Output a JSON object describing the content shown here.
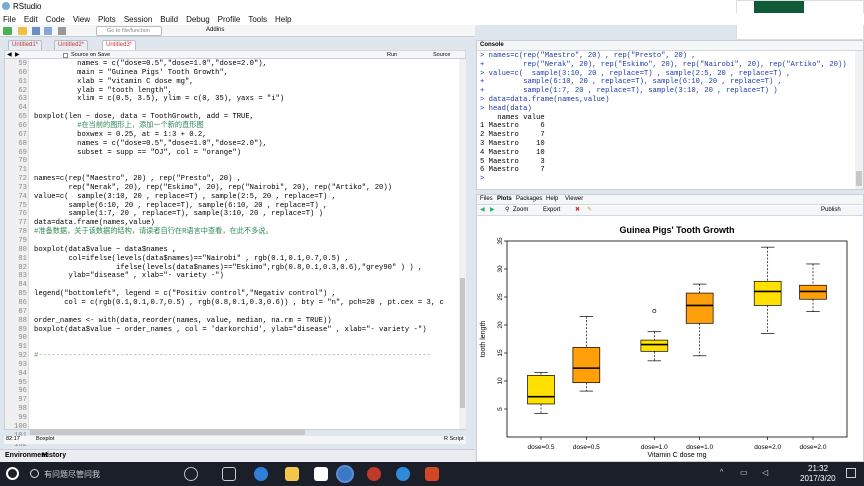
{
  "app": {
    "title": "RStudio"
  },
  "menu": [
    "File",
    "Edit",
    "Code",
    "View",
    "Plots",
    "Session",
    "Build",
    "Debug",
    "Profile",
    "Tools",
    "Help"
  ],
  "toolbar": {
    "goto_placeholder": "Go to file/function",
    "addins": "Addins"
  },
  "editor_tabs": [
    {
      "label": "Untitled1*"
    },
    {
      "label": "Untitled2*"
    },
    {
      "label": "Untitled3*"
    }
  ],
  "editor_toolbar": {
    "source_on_save": "Source on Save",
    "run": "Run",
    "source": "Source"
  },
  "editor": {
    "lines": [
      {
        "n": "59",
        "code": "          names = c(\"dose=0.5\",\"dose=1.0\",\"dose=2.0\"),"
      },
      {
        "n": "60",
        "code": "          main = \"Guinea Pigs' Tooth Growth\","
      },
      {
        "n": "61",
        "code": "          xlab = \"vitamin C dose mg\","
      },
      {
        "n": "62",
        "code": "          ylab = \"tooth length\","
      },
      {
        "n": "63",
        "code": "          xlim = c(0.5, 3.5), ylim = c(0, 35), yaxs = \"i\")"
      },
      {
        "n": "64",
        "code": ""
      },
      {
        "n": "65",
        "code": "boxplot(len ~ dose, data = ToothGrowth, add = TRUE,"
      },
      {
        "n": "66",
        "code": "          #在当前的图形上，添加一个新的直形图"
      },
      {
        "n": "67",
        "code": "          boxwex = 0.25, at = 1:3 + 0.2,"
      },
      {
        "n": "68",
        "code": "          names = c(\"dose=0.5\",\"dose=1.0\",\"dose=2.0\"),"
      },
      {
        "n": "69",
        "code": "          subset = supp == \"OJ\", col = \"orange\")"
      },
      {
        "n": "70",
        "code": ""
      },
      {
        "n": "71",
        "code": ""
      },
      {
        "n": "72",
        "code": "names=c(rep(\"Maestro\", 20) , rep(\"Presto\", 20) ,"
      },
      {
        "n": "73",
        "code": "        rep(\"Nerak\", 20), rep(\"Eskimo\", 20), rep(\"Nairobi\", 20), rep(\"Artiko\", 20))"
      },
      {
        "n": "74",
        "code": "value=c(  sample(3:10, 20 , replace=T) , sample(2:5, 20 , replace=T) ,"
      },
      {
        "n": "75",
        "code": "        sample(6:10, 20 , replace=T), sample(6:10, 20 , replace=T) ,"
      },
      {
        "n": "76",
        "code": "        sample(1:7, 20 , replace=T), sample(3:10, 20 , replace=T) )"
      },
      {
        "n": "77",
        "code": "data=data.frame(names,value)"
      },
      {
        "n": "78",
        "code": "#准备数据，关于该数据的结构，请读者自行在R语言中查看，在此不多说。"
      },
      {
        "n": "79",
        "code": ""
      },
      {
        "n": "80",
        "code": "boxplot(data$value ~ data$names ,"
      },
      {
        "n": "81",
        "code": "        col=ifelse(levels(data$names)==\"Nairobi\" , rgb(0.1,0.1,0.7,0.5) ,"
      },
      {
        "n": "82",
        "code": "                   ifelse(levels(data$names)==\"Eskimo\",rgb(0.8,0.1,0.3,0.6),\"grey90\" ) ) ,"
      },
      {
        "n": "83",
        "code": "        ylab=\"disease\" , xlab=\"- variety -\")"
      },
      {
        "n": "84",
        "code": ""
      },
      {
        "n": "85",
        "code": "legend(\"bottomleft\", legend = c(\"Positiv control\",\"Negativ control\") ,"
      },
      {
        "n": "86",
        "code": "       col = c(rgb(0.1,0.1,0.7,0.5) , rgb(0.8,0.1,0.3,0.6)) , bty = \"n\", pch=20 , pt.cex = 3, c"
      },
      {
        "n": "87",
        "code": ""
      },
      {
        "n": "88",
        "code": "order_names <- with(data,reorder(names, value, median, na.rm = TRUE))"
      },
      {
        "n": "89",
        "code": "boxplot(data$value ~ order_names , col = 'darkorchid', ylab=\"disease\" , xlab=\"- variety -\")"
      },
      {
        "n": "90",
        "code": ""
      },
      {
        "n": "91",
        "code": ""
      },
      {
        "n": "92",
        "code": "#-------------------------------------------------------------------------------------------"
      },
      {
        "n": "93",
        "code": ""
      },
      {
        "n": "94",
        "code": ""
      },
      {
        "n": "95",
        "code": ""
      },
      {
        "n": "96",
        "code": ""
      },
      {
        "n": "97",
        "code": ""
      },
      {
        "n": "98",
        "code": ""
      },
      {
        "n": "99",
        "code": ""
      },
      {
        "n": "100",
        "code": ""
      },
      {
        "n": "101",
        "code": ""
      },
      {
        "n": "102",
        "code": ""
      },
      {
        "n": "103",
        "code": ""
      },
      {
        "n": "104",
        "code": ""
      }
    ],
    "status_pos": "82:17",
    "status_scope": "Boxplot",
    "status_lang": "R Script"
  },
  "console": {
    "title": "Console",
    "lines": [
      {
        "t": "cmd",
        "s": "> names=c(rep(\"Maestro\", 20) , rep(\"Presto\", 20) ,"
      },
      {
        "t": "cmd",
        "s": "+         rep(\"Nerak\", 20), rep(\"Eskimo\", 20), rep(\"Nairobi\", 20), rep(\"Artiko\", 20))"
      },
      {
        "t": "cmd",
        "s": "> value=c(  sample(3:10, 20 , replace=T) , sample(2:5, 20 , replace=T) ,"
      },
      {
        "t": "cmd",
        "s": "+         sample(6:10, 20 , replace=T), sample(6:10, 20 , replace=T) ,"
      },
      {
        "t": "cmd",
        "s": "+         sample(1:7, 20 , replace=T), sample(3:10, 20 , replace=T) )"
      },
      {
        "t": "cmd",
        "s": "> data=data.frame(names,value)"
      },
      {
        "t": "cmd",
        "s": "> head(data)"
      },
      {
        "t": "out",
        "s": "    names value"
      },
      {
        "t": "out",
        "s": "1 Maestro     6"
      },
      {
        "t": "out",
        "s": "2 Maestro     7"
      },
      {
        "t": "out",
        "s": "3 Maestro    10"
      },
      {
        "t": "out",
        "s": "4 Maestro    10"
      },
      {
        "t": "out",
        "s": "5 Maestro     3"
      },
      {
        "t": "out",
        "s": "6 Maestro     7"
      },
      {
        "t": "cmd",
        "s": "> "
      }
    ]
  },
  "plot_tabs": [
    "Files",
    "Plots",
    "Packages",
    "Help",
    "Viewer"
  ],
  "plot_toolbar": {
    "zoom": "Zoom",
    "export": "Export",
    "publish": "Publish"
  },
  "env_tabs": [
    "Environment",
    "History"
  ],
  "taskbar": {
    "search_placeholder": "有问题尽管问我",
    "time": "21:32",
    "date": "2017/3/20"
  },
  "chart_data": {
    "type": "boxplot",
    "title": "Guinea Pigs' Tooth Growth",
    "xlabel": "Vitamin C dose mg",
    "ylabel": "tooth length",
    "ylim": [
      0,
      35
    ],
    "yticks": [
      5,
      10,
      15,
      20,
      25,
      30,
      35
    ],
    "categories": [
      "dose=0.5",
      "dose=0.5",
      "dose=1.0",
      "dose=1.0",
      "dose=2.0",
      "dose=2.0"
    ],
    "boxes": [
      {
        "label": "dose=0.5",
        "color": "#ffe000",
        "min": 4.2,
        "q1": 5.9,
        "median": 7.2,
        "q3": 11.0,
        "max": 11.5,
        "outliers": []
      },
      {
        "label": "dose=0.5",
        "color": "#ff9f0a",
        "min": 8.2,
        "q1": 9.7,
        "median": 12.3,
        "q3": 16.0,
        "max": 21.5,
        "outliers": []
      },
      {
        "label": "dose=1.0",
        "color": "#ffe000",
        "min": 13.6,
        "q1": 15.3,
        "median": 16.5,
        "q3": 17.3,
        "max": 18.8,
        "outliers": [
          22.5
        ]
      },
      {
        "label": "dose=1.0",
        "color": "#ff9f0a",
        "min": 14.5,
        "q1": 20.3,
        "median": 23.5,
        "q3": 25.7,
        "max": 27.3,
        "outliers": []
      },
      {
        "label": "dose=2.0",
        "color": "#ffe000",
        "min": 18.5,
        "q1": 23.5,
        "median": 26.0,
        "q3": 27.8,
        "max": 33.9,
        "outliers": []
      },
      {
        "label": "dose=2.0",
        "color": "#ff9f0a",
        "min": 22.4,
        "q1": 24.6,
        "median": 26.0,
        "q3": 27.1,
        "max": 30.9,
        "outliers": []
      }
    ],
    "positions": [
      0.8,
      1.2,
      1.8,
      2.2,
      2.8,
      3.2
    ],
    "xlim": [
      0.5,
      3.5
    ]
  }
}
